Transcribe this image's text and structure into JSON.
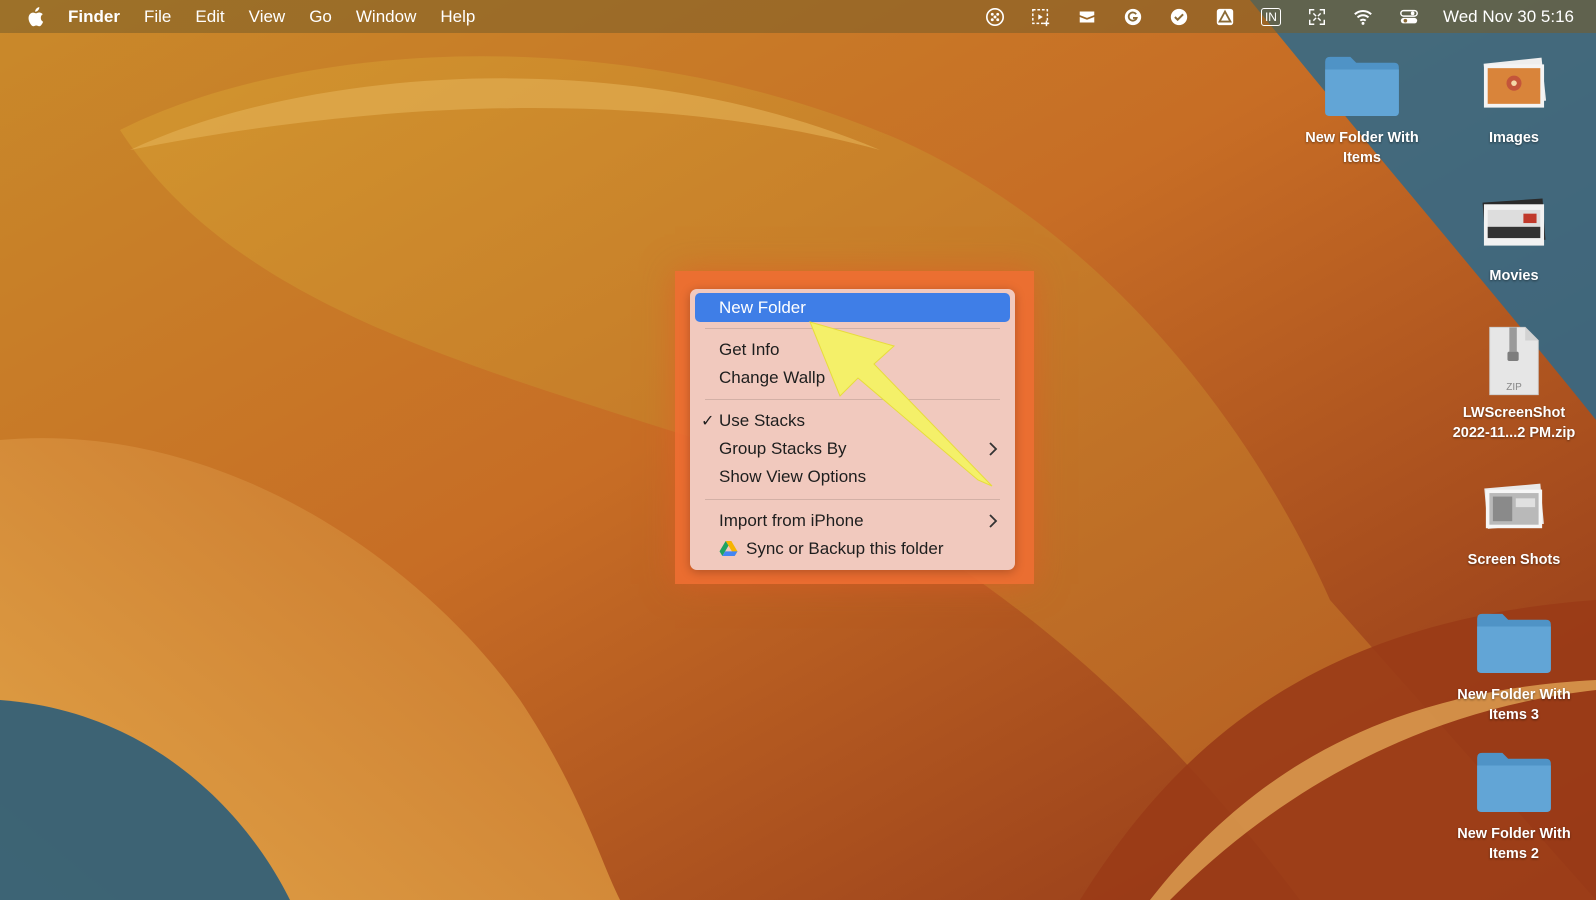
{
  "menubar": {
    "app_name": "Finder",
    "menus": [
      "File",
      "Edit",
      "View",
      "Go",
      "Window",
      "Help"
    ],
    "status_icons": [
      "globe-grid-icon",
      "screen-capture-icon",
      "reminders-icon",
      "grammarly-icon",
      "todo-check-icon",
      "drive-icon",
      "input-source-icon",
      "fullscreen-icon",
      "wifi-icon",
      "control-center-icon"
    ],
    "input_source_label": "IN",
    "clock": "Wed Nov 30  5:16"
  },
  "context_menu": {
    "items": [
      {
        "label": "New Folder",
        "highlighted": true
      },
      {
        "label": "Get Info"
      },
      {
        "label": "Change Wallp"
      },
      {
        "label": "Use Stacks",
        "checked": true
      },
      {
        "label": "Group Stacks By",
        "submenu": true
      },
      {
        "label": "Show View Options"
      },
      {
        "label": "Import from iPhone",
        "submenu": true
      },
      {
        "label": "Sync or Backup this folder",
        "icon": "google-drive-icon"
      }
    ]
  },
  "desktop_icons": [
    {
      "name": "New Folder With Items",
      "line1": "New Folder With",
      "line2": "Items",
      "icon": "folder-icon"
    },
    {
      "name": "Images",
      "line1": "Images",
      "line2": "",
      "icon": "stack-icon"
    },
    {
      "name": "Movies",
      "line1": "Movies",
      "line2": "",
      "icon": "stack-icon"
    },
    {
      "name": "LWScreenShot 2022-11...2 PM.zip",
      "line1": "LWScreenShot",
      "line2": "2022-11...2 PM.zip",
      "icon": "zip-file-icon",
      "zip_label": "ZIP"
    },
    {
      "name": "Screen Shots",
      "line1": "Screen Shots",
      "line2": "",
      "icon": "stack-icon"
    },
    {
      "name": "New Folder With Items 3",
      "line1": "New Folder With",
      "line2": "Items 3",
      "icon": "folder-icon"
    },
    {
      "name": "New Folder With Items 2",
      "line1": "New Folder With",
      "line2": "Items 2",
      "icon": "folder-icon"
    }
  ],
  "colors": {
    "menu_highlight": "#3f7ee7",
    "folder_blue": "#5a9fd0",
    "arrow_yellow": "#f4f069"
  }
}
